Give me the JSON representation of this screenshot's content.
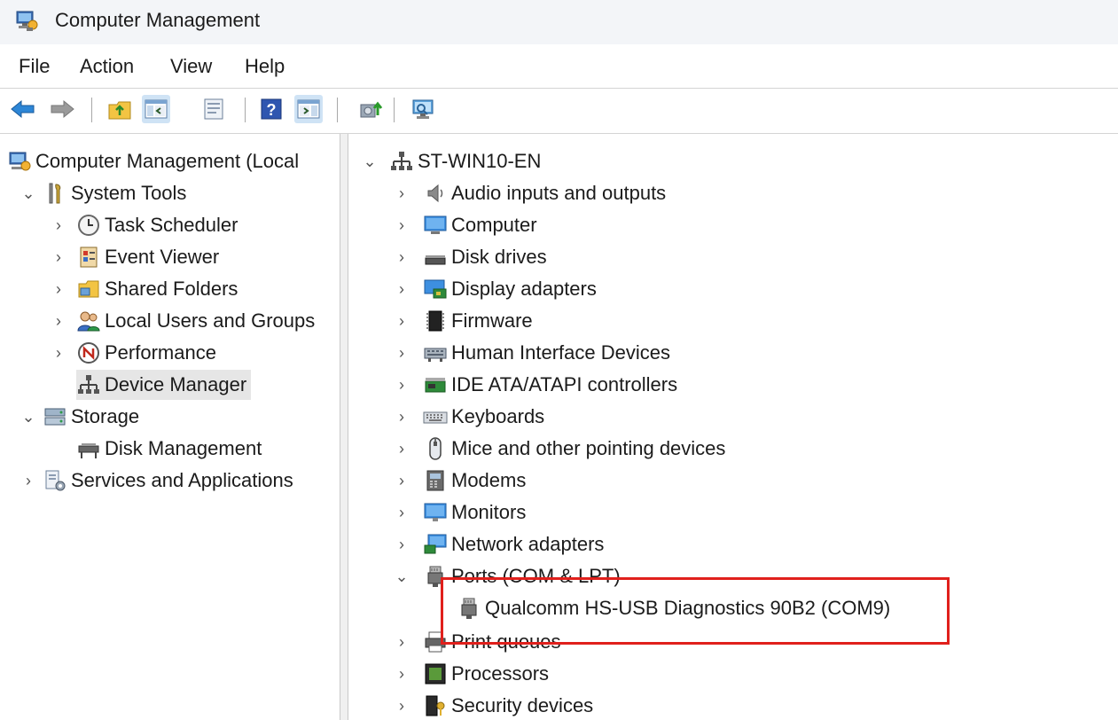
{
  "window": {
    "title": "Computer Management",
    "icon": "computer-management-icon"
  },
  "menu": {
    "items": [
      "File",
      "Action",
      "View",
      "Help"
    ]
  },
  "toolbar": {
    "buttons": [
      "back-arrow-icon",
      "forward-arrow-icon",
      "up-folder-icon",
      "show-hide-console-tree-icon",
      "properties-icon",
      "help-icon",
      "show-hide-action-pane-icon",
      "update-driver-icon",
      "scan-hardware-icon"
    ]
  },
  "left_tree": {
    "root": "Computer Management (Local",
    "system_tools": "System Tools",
    "task_scheduler": "Task Scheduler",
    "event_viewer": "Event Viewer",
    "shared_folders": "Shared Folders",
    "local_users": "Local Users and Groups",
    "performance": "Performance",
    "device_manager": "Device Manager",
    "storage": "Storage",
    "disk_management": "Disk Management",
    "services": "Services and Applications",
    "selected": "Device Manager"
  },
  "device_tree": {
    "root": "ST-WIN10-EN",
    "categories": [
      "Audio inputs and outputs",
      "Computer",
      "Disk drives",
      "Display adapters",
      "Firmware",
      "Human Interface Devices",
      "IDE ATA/ATAPI controllers",
      "Keyboards",
      "Mice and other pointing devices",
      "Modems",
      "Monitors",
      "Network adapters",
      "Ports (COM & LPT)",
      "Print queues",
      "Processors",
      "Security devices"
    ],
    "expanded_category": "Ports (COM & LPT)",
    "port_device": "Qualcomm HS-USB Diagnostics 90B2 (COM9)"
  },
  "colors": {
    "highlight_box": "#e0201c",
    "selected_row": "#e6e6e6"
  }
}
